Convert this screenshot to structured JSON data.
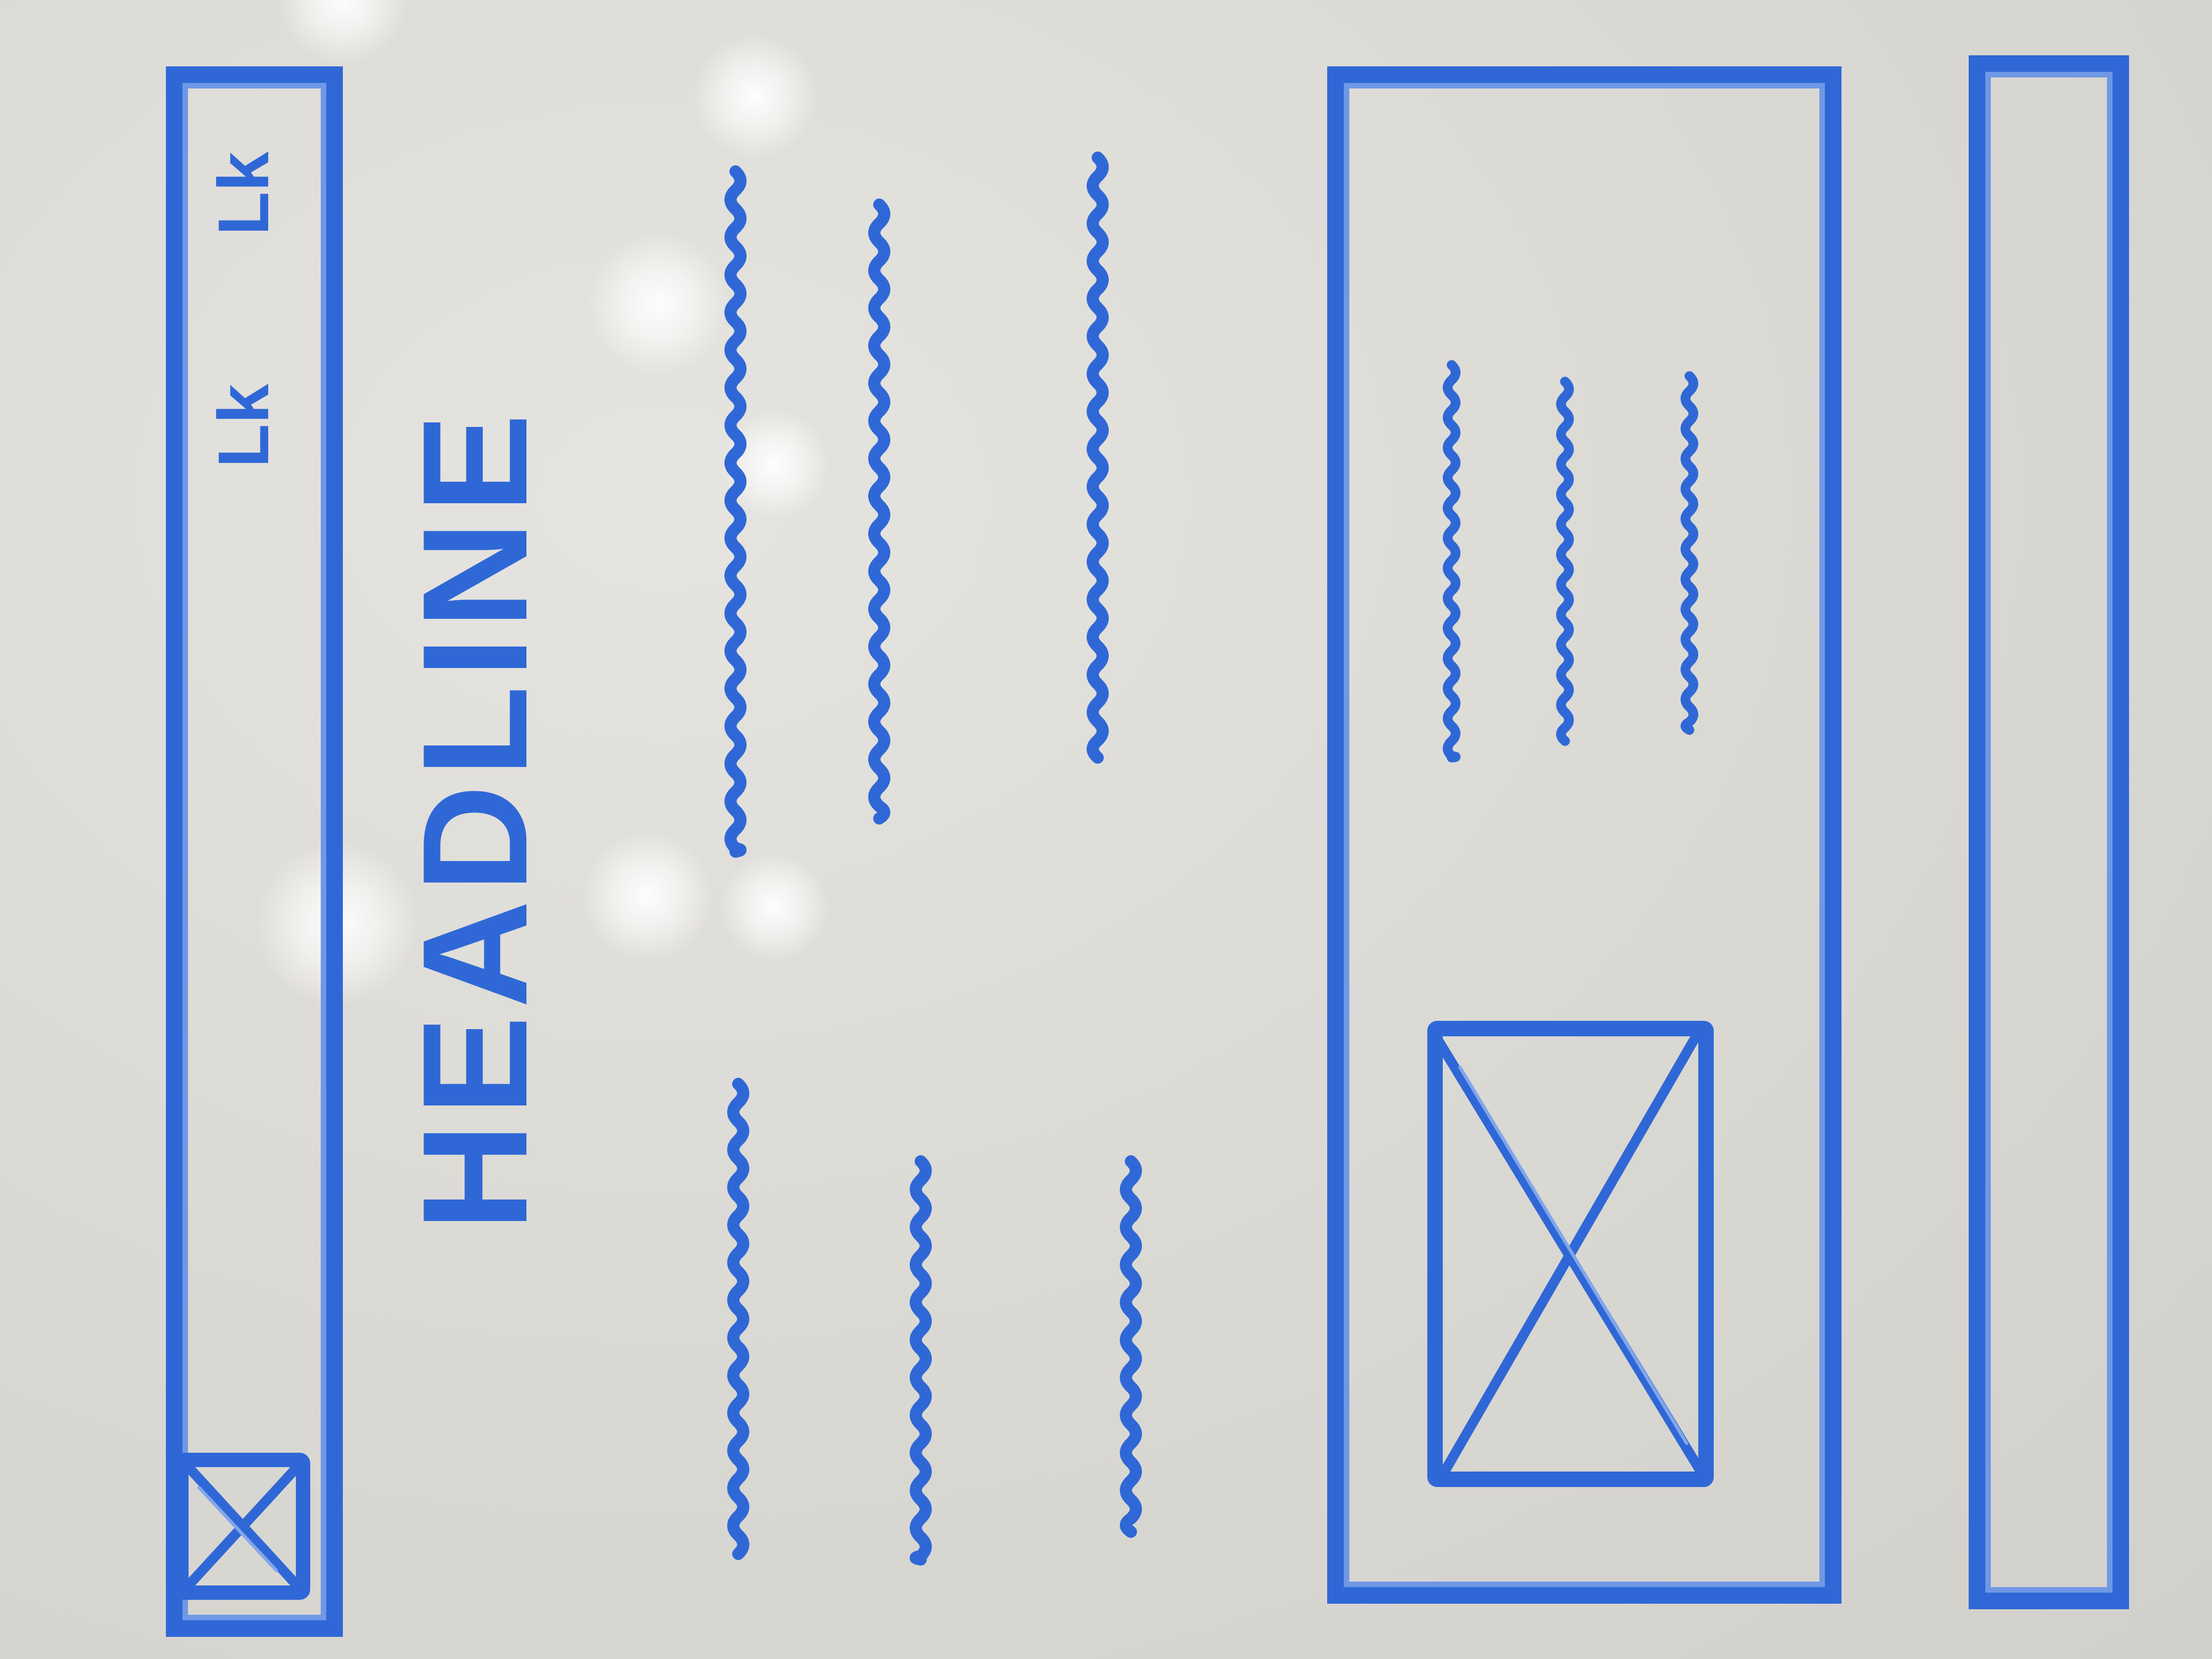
{
  "header_bar": {
    "nav_link_1": "Lk",
    "nav_link_2": "Lk"
  },
  "content": {
    "headline": "HEADLINE"
  },
  "colors": {
    "marker": "#2f68d6",
    "board": "#dcdad6"
  },
  "icons": {
    "logo": "image-placeholder-icon",
    "card_image": "image-placeholder-icon"
  }
}
